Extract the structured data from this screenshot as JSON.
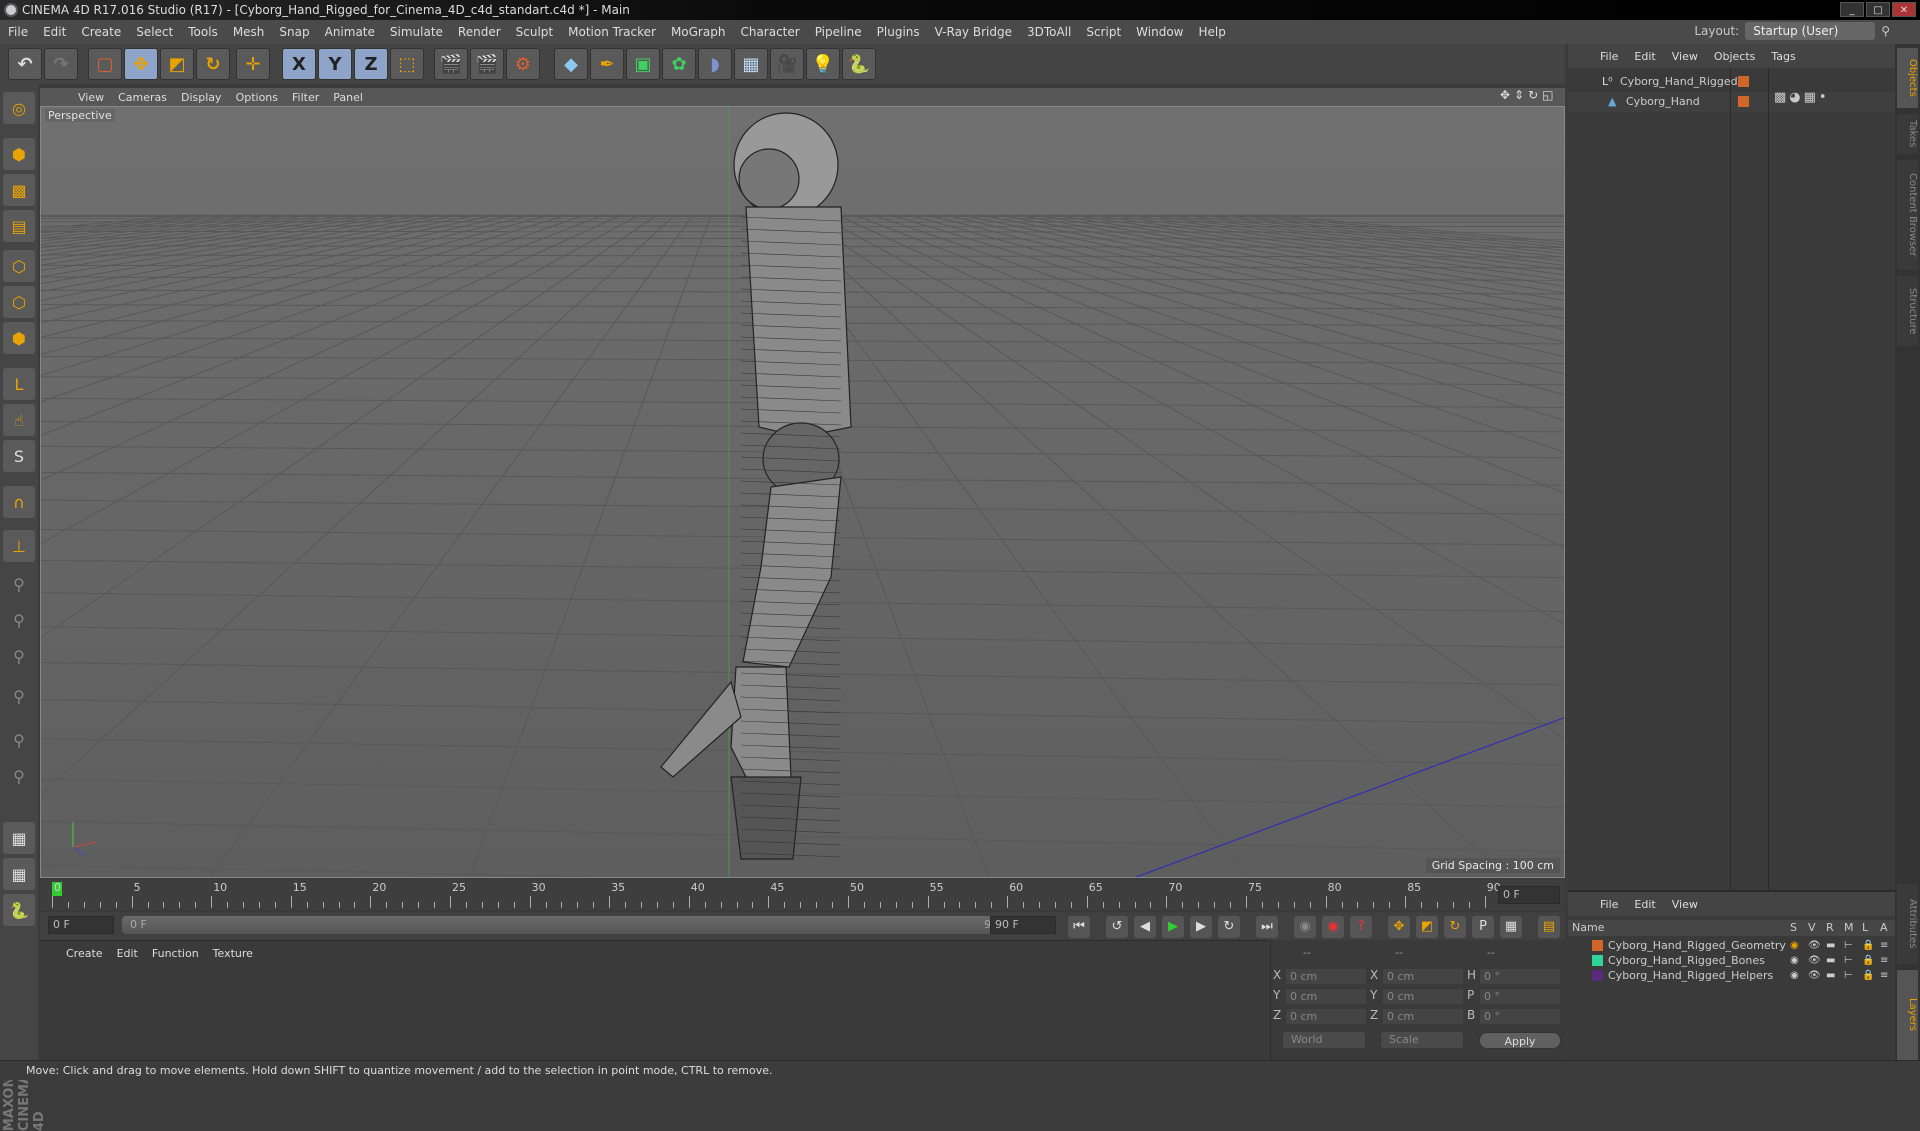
{
  "window": {
    "title": "CINEMA 4D R17.016 Studio (R17) - [Cyborg_Hand_Rigged_for_Cinema_4D_c4d_standart.c4d *] - Main",
    "controls": [
      "_",
      "□",
      "✕"
    ]
  },
  "menu": [
    "File",
    "Edit",
    "Create",
    "Select",
    "Tools",
    "Mesh",
    "Snap",
    "Animate",
    "Simulate",
    "Render",
    "Sculpt",
    "Motion Tracker",
    "MoGraph",
    "Character",
    "Pipeline",
    "Plugins",
    "V-Ray Bridge",
    "3DToAll",
    "Script",
    "Window",
    "Help"
  ],
  "layout": {
    "label": "Layout:",
    "value": "Startup (User)"
  },
  "toolbar": {
    "x": "X",
    "y": "Y",
    "z": "Z"
  },
  "viewport": {
    "menu": [
      "View",
      "Cameras",
      "Display",
      "Options",
      "Filter",
      "Panel"
    ],
    "label": "Perspective",
    "grid_spacing": "Grid Spacing : 100 cm",
    "axis_y": "Y",
    "axis_x": "X"
  },
  "timeline": {
    "ticks": [
      "0",
      "5",
      "10",
      "15",
      "20",
      "25",
      "30",
      "35",
      "40",
      "45",
      "50",
      "55",
      "60",
      "65",
      "70",
      "75",
      "80",
      "85",
      "90"
    ],
    "current_frame": "0 F",
    "start": "0 F",
    "range_start": "0 F",
    "range_end": "90 F",
    "end": "90 F",
    "end_field": "0 F"
  },
  "materials": {
    "menu": [
      "Create",
      "Edit",
      "Function",
      "Texture"
    ]
  },
  "coords": {
    "headers": [
      "--",
      "--",
      "--"
    ],
    "rows": [
      [
        "X",
        "0 cm",
        "X",
        "0 cm",
        "H",
        "0 °"
      ],
      [
        "Y",
        "0 cm",
        "Y",
        "0 cm",
        "P",
        "0 °"
      ],
      [
        "Z",
        "0 cm",
        "Z",
        "0 cm",
        "B",
        "0 °"
      ]
    ],
    "mode": "World",
    "type": "Scale",
    "apply": "Apply"
  },
  "objects": {
    "menu": [
      "File",
      "Edit",
      "View",
      "Objects",
      "Tags"
    ],
    "items": [
      {
        "name": "Cyborg_Hand_Rigged",
        "color": "#d0662a"
      },
      {
        "name": "Cyborg_Hand",
        "color": "#d0662a"
      }
    ]
  },
  "layers": {
    "menu": [
      "File",
      "Edit",
      "View"
    ],
    "columns": [
      "Name",
      "S",
      "V",
      "R",
      "M",
      "L",
      "A"
    ],
    "items": [
      {
        "name": "Cyborg_Hand_Rigged_Geometry",
        "color": "#d0662a"
      },
      {
        "name": "Cyborg_Hand_Rigged_Bones",
        "color": "#2fd49a"
      },
      {
        "name": "Cyborg_Hand_Rigged_Helpers",
        "color": "#5a2a7a"
      }
    ]
  },
  "sidetabs": [
    "Objects",
    "Takes",
    "Content Browser",
    "Structure",
    "Attributes",
    "Layers"
  ],
  "brand": "MAXON CINEMA 4D",
  "status": "Move: Click and drag to move elements. Hold down SHIFT to quantize movement / add to the selection in point mode, CTRL to remove."
}
